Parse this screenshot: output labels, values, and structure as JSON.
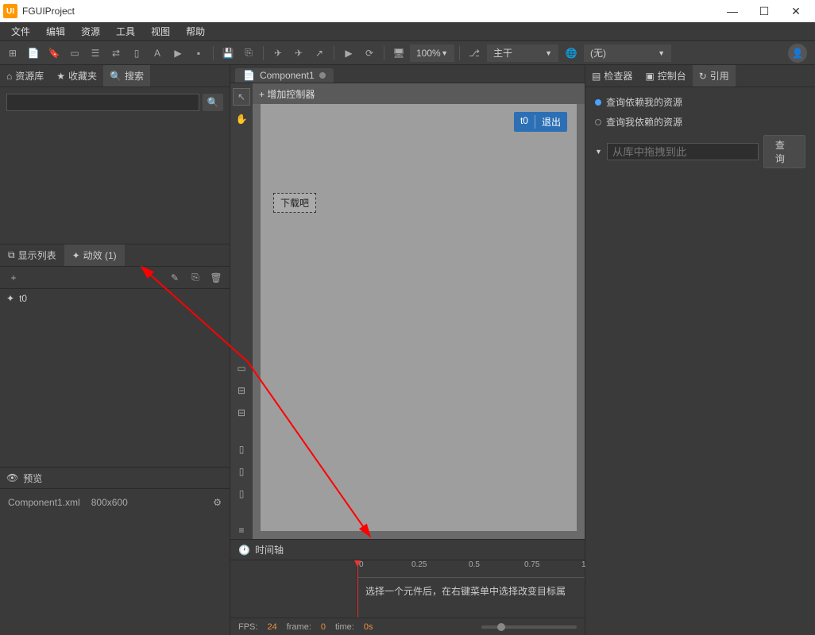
{
  "titlebar": {
    "title": "FGUIProject"
  },
  "menu": [
    "文件",
    "编辑",
    "资源",
    "工具",
    "视图",
    "帮助"
  ],
  "toolbar": {
    "zoom": "100%",
    "branch": "主干",
    "none": "(无)"
  },
  "left": {
    "tabs": {
      "assets": "资源库",
      "favs": "收藏夹",
      "search": "搜索"
    },
    "listtabs": {
      "display": "显示列表",
      "anim": "动效 (1)"
    },
    "anim_item": "t0",
    "preview": {
      "title": "预览",
      "file": "Component1.xml",
      "size": "800x600"
    }
  },
  "center": {
    "doctab": "Component1",
    "add_controller": "增加控制器",
    "t0_label": "t0",
    "exit_label": "退出",
    "download_label": "下载吧",
    "timeline": {
      "title": "时间轴",
      "hint": "选择一个元件后，在右键菜单中选择改变目标属",
      "ticks": [
        "0",
        "0.25",
        "0.5",
        "0.75",
        "1"
      ],
      "fps_label": "FPS:",
      "fps_val": "24",
      "frame_label": "frame:",
      "frame_val": "0",
      "time_label": "time:",
      "time_val": "0s"
    }
  },
  "right": {
    "tabs": {
      "inspector": "检查器",
      "console": "控制台",
      "refs": "引用"
    },
    "radio1": "查询依赖我的资源",
    "radio2": "查询我依赖的资源",
    "drop_placeholder": "从库中拖拽到此",
    "query_btn": "查询"
  }
}
